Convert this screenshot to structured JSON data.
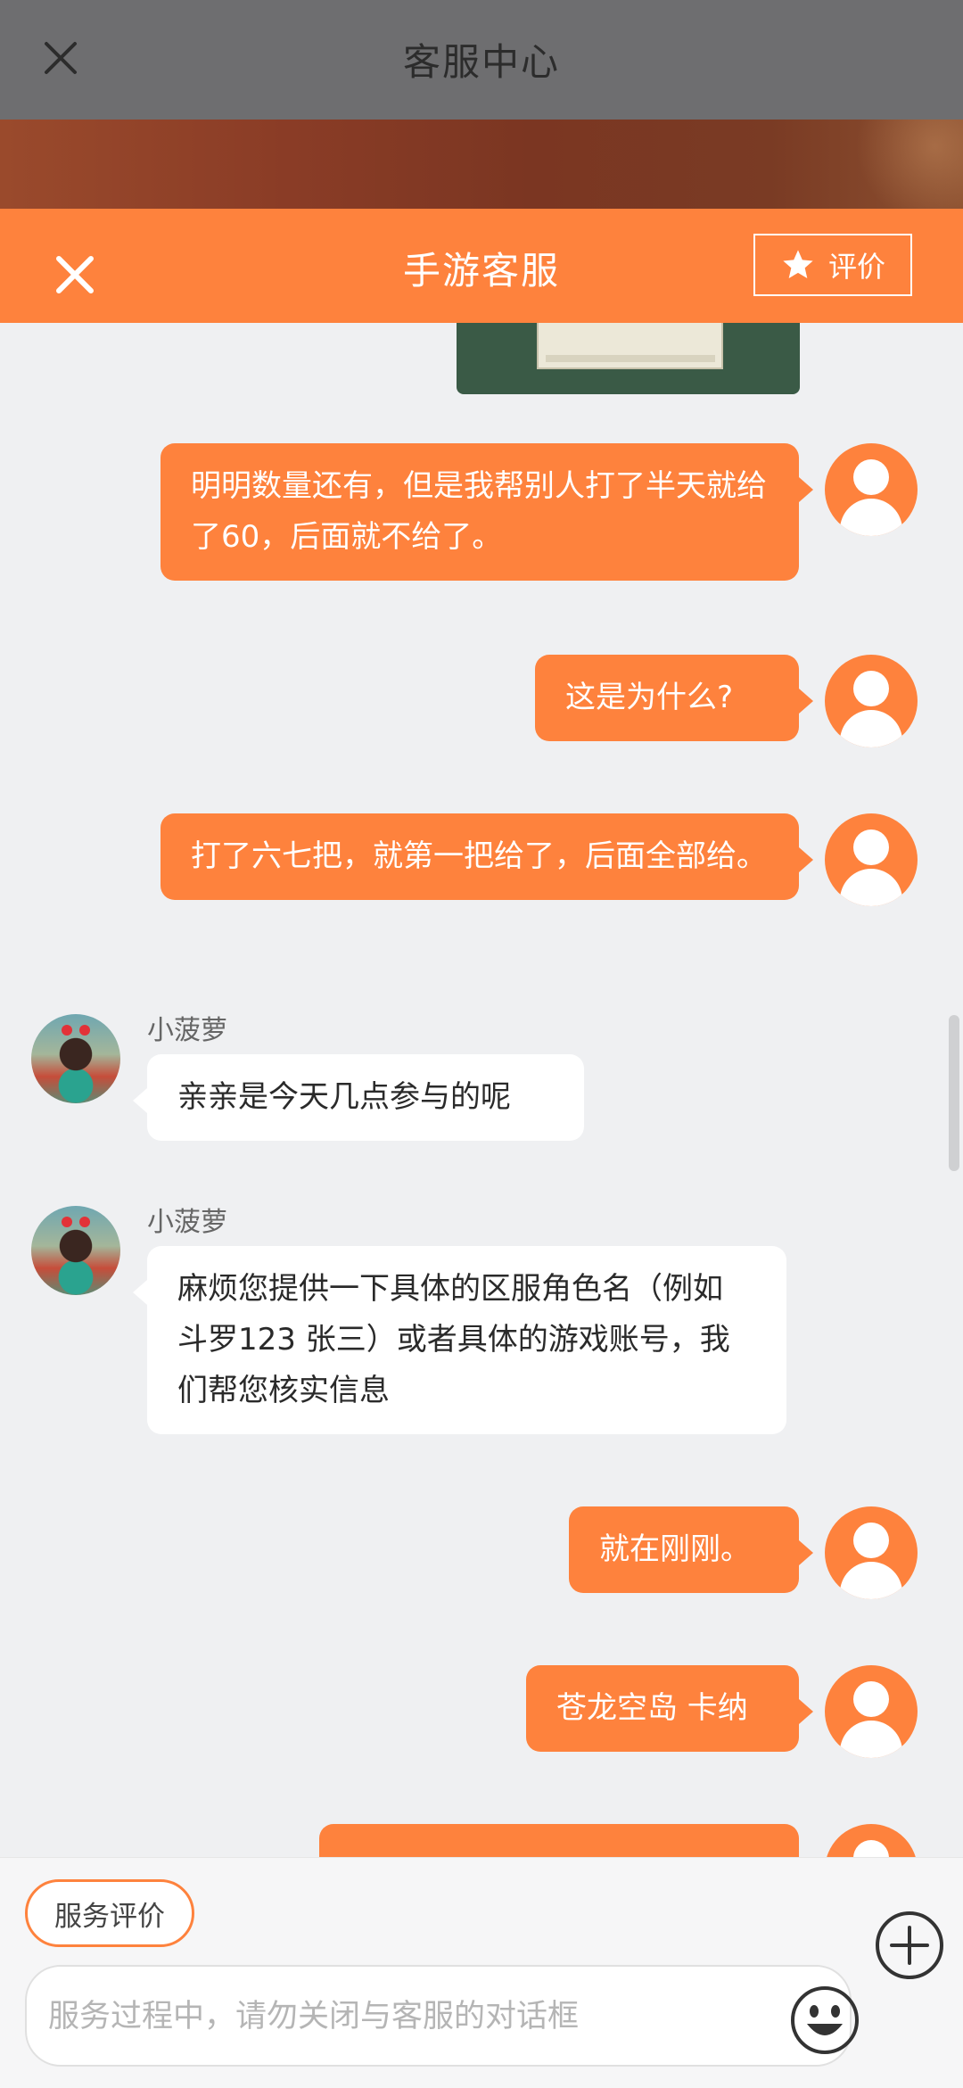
{
  "outer_header": {
    "title": "客服中心",
    "close_icon": "close-icon"
  },
  "chat_header": {
    "title": "手游客服",
    "rate_label": "评价",
    "close_icon": "close-icon",
    "rate_icon": "star-icon"
  },
  "colors": {
    "brand": "#fe823d",
    "outer_header": "#6e6e70",
    "chat_bg": "#eff0f2"
  },
  "messages": [
    {
      "side": "out",
      "text": "明明数量还有，但是我帮别人打了半天就给了60，后面就不给了。"
    },
    {
      "side": "out",
      "text": "这是为什么?"
    },
    {
      "side": "out",
      "text": "打了六七把，就第一把给了，后面全部给。"
    },
    {
      "side": "in",
      "sender": "小菠萝",
      "text": "亲亲是今天几点参与的呢"
    },
    {
      "side": "in",
      "sender": "小菠萝",
      "text": "麻烦您提供一下具体的区服角色名（例如 斗罗123 张三）或者具体的游戏账号，我们帮您核实信息"
    },
    {
      "side": "out",
      "text": "就在刚刚。"
    },
    {
      "side": "out",
      "text": "苍龙空岛 卡纳"
    }
  ],
  "footer": {
    "service_rate_label": "服务评价",
    "input_placeholder": "服务过程中，请勿关闭与客服的对话框",
    "emoji_icon": "emoji-icon",
    "plus_icon": "plus-icon"
  }
}
